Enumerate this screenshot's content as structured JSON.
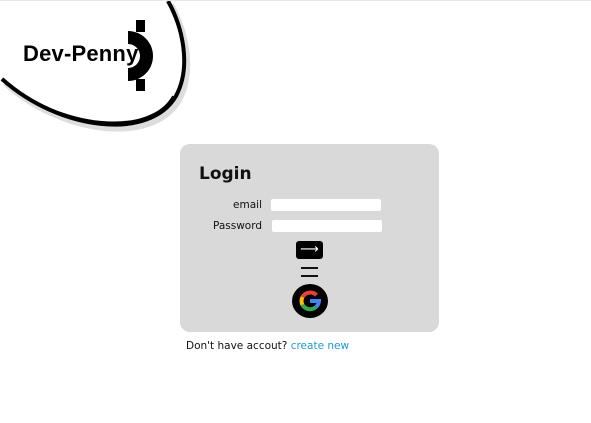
{
  "brand": {
    "name": "Dev-Penny"
  },
  "login": {
    "title": "Login",
    "email_label": "email",
    "email_value": "",
    "password_label": "Password",
    "password_value": "",
    "submit_icon": "arrow-right-icon",
    "google_icon": "google-icon"
  },
  "footer": {
    "prompt": "Don't have accout?",
    "link": "create new"
  },
  "colors": {
    "card": "#d9d9d9",
    "link": "#1e9ad6"
  }
}
